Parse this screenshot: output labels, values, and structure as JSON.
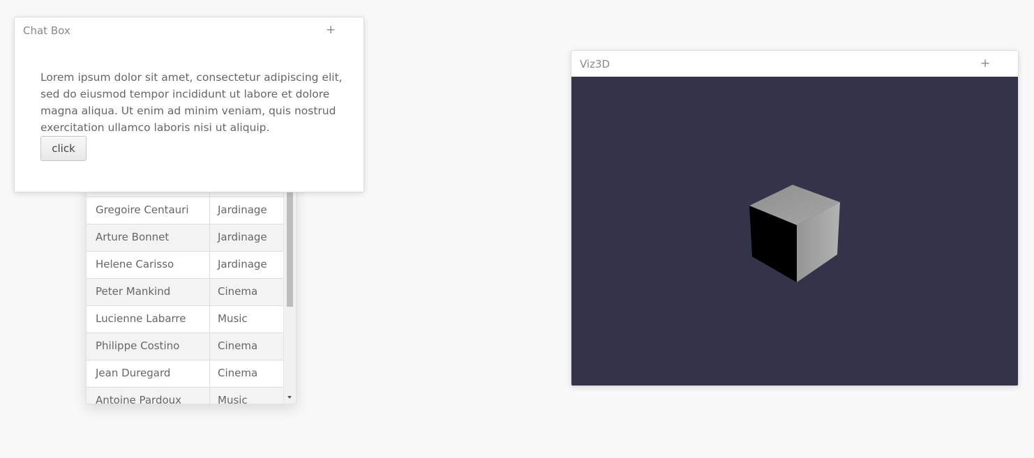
{
  "table": {
    "rows": [
      {
        "name": "Gregoire Centauri",
        "hobby": "Jardinage"
      },
      {
        "name": "Arture Bonnet",
        "hobby": "Jardinage"
      },
      {
        "name": "Helene Carisso",
        "hobby": "Jardinage"
      },
      {
        "name": "Peter Mankind",
        "hobby": "Cinema"
      },
      {
        "name": "Lucienne Labarre",
        "hobby": "Music"
      },
      {
        "name": "Philippe Costino",
        "hobby": "Cinema"
      },
      {
        "name": "Jean Duregard",
        "hobby": "Cinema"
      },
      {
        "name": "Antoine Pardoux",
        "hobby": "Music"
      }
    ]
  },
  "chat_box": {
    "title": "Chat Box",
    "expand_icon": "+",
    "text": "Lorem ipsum dolor sit amet, consectetur adipiscing elit, sed do eiusmod tempor incididunt ut labore et dolore magna aliqua. Ut enim ad minim veniam, quis nostrud exercitation ullamco laboris nisi ut aliquip.",
    "button_label": "click"
  },
  "viz3d": {
    "title": "Viz3D",
    "expand_icon": "+",
    "background_color": "#33334a",
    "object": "cube"
  }
}
